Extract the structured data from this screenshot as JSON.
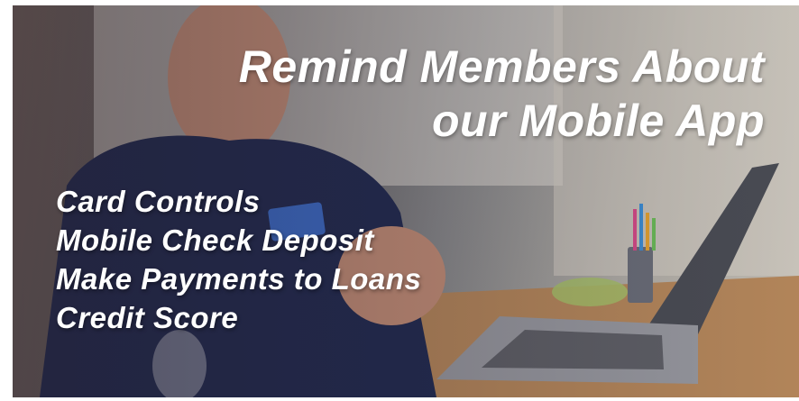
{
  "slide": {
    "headline_line1": "Remind Members About",
    "headline_line2": "our Mobile App",
    "features": [
      "Card Controls",
      "Mobile Check Deposit",
      "Make Payments to Loans",
      "Credit Score"
    ]
  },
  "colors": {
    "text": "#ffffff",
    "shirt": "#1f2a52",
    "card": "#3b6fd1",
    "desk": "#b98a5c"
  }
}
